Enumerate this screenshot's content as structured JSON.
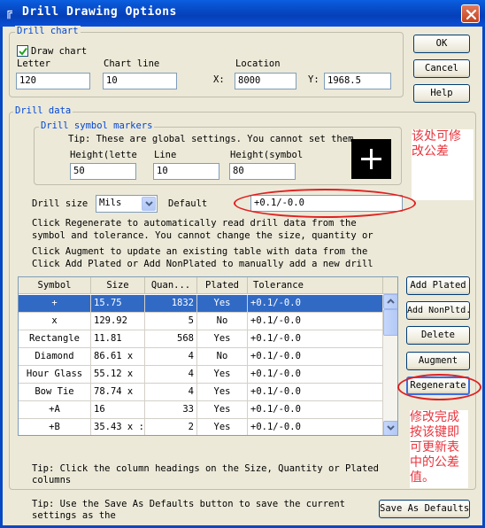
{
  "window": {
    "title": "Drill Drawing Options",
    "icon": "app-icon"
  },
  "drill_chart": {
    "group_label": "Drill chart",
    "draw_chart_label": "Draw chart",
    "draw_chart_checked": true,
    "letter_label": "Letter",
    "letter_value": "120",
    "chart_line_label": "Chart line",
    "chart_line_value": "10",
    "location_label": "Location",
    "x_label": "X:",
    "x_value": "8000",
    "y_label": "Y:",
    "y_value": "1968.5"
  },
  "buttons": {
    "ok": "OK",
    "cancel": "Cancel",
    "help": "Help",
    "add_plated": "Add Plated",
    "add_nonpltd": "Add NonPltd.",
    "delete": "Delete",
    "augment": "Augment",
    "regenerate": "Regenerate",
    "save_defaults": "Save As Defaults"
  },
  "drill_data": {
    "group_label": "Drill data",
    "symbol_markers": {
      "group_label": "Drill symbol markers",
      "tip": "Tip: These are global settings. You cannot set them",
      "height_letter_label": "Height(lette",
      "height_letter_value": "50",
      "line_label": "Line",
      "line_value": "10",
      "height_symbol_label": "Height(symbol",
      "height_symbol_value": "80",
      "preview_icon": "plus-symbol-icon"
    },
    "drill_size_label": "Drill size",
    "drill_size_unit": "Mils",
    "default_label": "Default",
    "default_value": "+0.1/-0.0",
    "instructions": [
      "Click Regenerate to automatically read drill data from the",
      "symbol and tolerance. You cannot change the size, quantity or",
      "Click Augment to update an existing table with data from the",
      "Click Add Plated or Add NonPlated to manually add a new drill"
    ],
    "table": {
      "columns": [
        "Symbol",
        "Size",
        "Quan...",
        "Plated",
        "Tolerance"
      ],
      "rows": [
        {
          "symbol": "+",
          "size": "15.75",
          "qty": "1832",
          "plated": "Yes",
          "tol": "+0.1/-0.0",
          "selected": true
        },
        {
          "symbol": "x",
          "size": "129.92",
          "qty": "5",
          "plated": "No",
          "tol": "+0.1/-0.0"
        },
        {
          "symbol": "Rectangle",
          "size": "11.81",
          "qty": "568",
          "plated": "Yes",
          "tol": "+0.1/-0.0"
        },
        {
          "symbol": "Diamond",
          "size": "86.61 x",
          "qty": "4",
          "plated": "No",
          "tol": "+0.1/-0.0"
        },
        {
          "symbol": "Hour Glass",
          "size": "55.12 x",
          "qty": "4",
          "plated": "Yes",
          "tol": "+0.1/-0.0"
        },
        {
          "symbol": "Bow Tie",
          "size": "78.74 x",
          "qty": "4",
          "plated": "Yes",
          "tol": "+0.1/-0.0"
        },
        {
          "symbol": "+A",
          "size": "16",
          "qty": "33",
          "plated": "Yes",
          "tol": "+0.1/-0.0"
        },
        {
          "symbol": "+B",
          "size": "35.43 x :",
          "qty": "2",
          "plated": "Yes",
          "tol": "+0.1/-0.0"
        }
      ]
    },
    "tip_columns": [
      "Tip: Click the column headings on the Size, Quantity or Plated",
      "columns"
    ]
  },
  "footer_tip": [
    "Tip: Use the Save As Defaults button to save the current",
    "settings as the"
  ],
  "annotations": {
    "note1": [
      "该处可修",
      "改公差"
    ],
    "note2": [
      "修改完成",
      "按该键即",
      "可更新表",
      "中的公差",
      "值。"
    ],
    "color": "#e8343c"
  },
  "colors": {
    "titlebar": "#0748c4",
    "group_label": "#0046d5",
    "selection": "#316ac5",
    "dialog_bg": "#ece9d8"
  }
}
